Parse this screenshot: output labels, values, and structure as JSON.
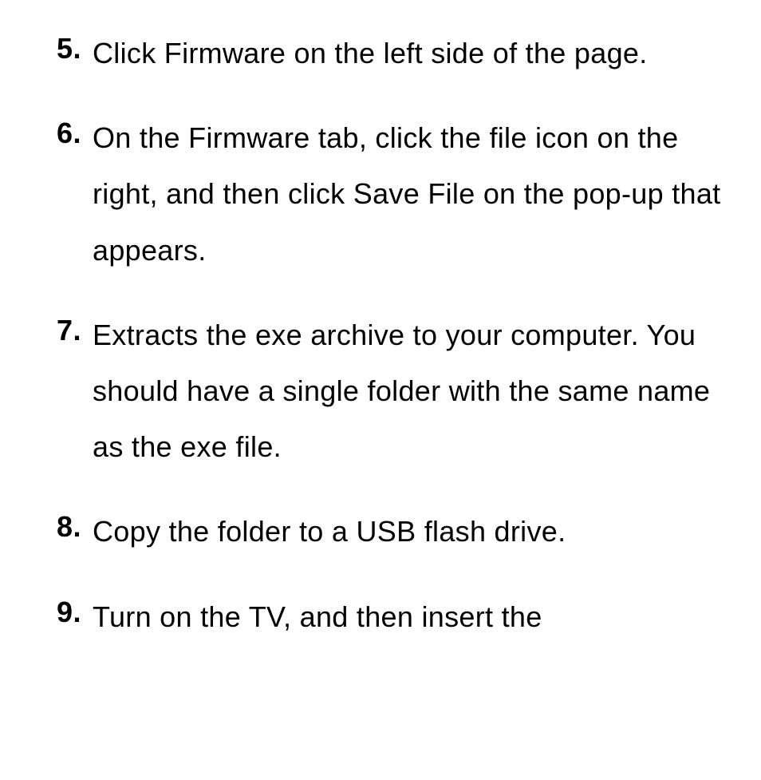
{
  "items": [
    {
      "marker": "5.",
      "text": "Click Firmware on the left side of the page."
    },
    {
      "marker": "6.",
      "text": "On the Firmware tab, click the file icon on the right, and then click Save File on the pop-up that appears."
    },
    {
      "marker": "7.",
      "text": "Extracts the exe archive to your computer. You should have a single folder with the same name as the exe file."
    },
    {
      "marker": "8.",
      "text": "Copy the folder to a USB flash drive."
    },
    {
      "marker": "9.",
      "text": "Turn on the TV, and then insert the"
    }
  ]
}
